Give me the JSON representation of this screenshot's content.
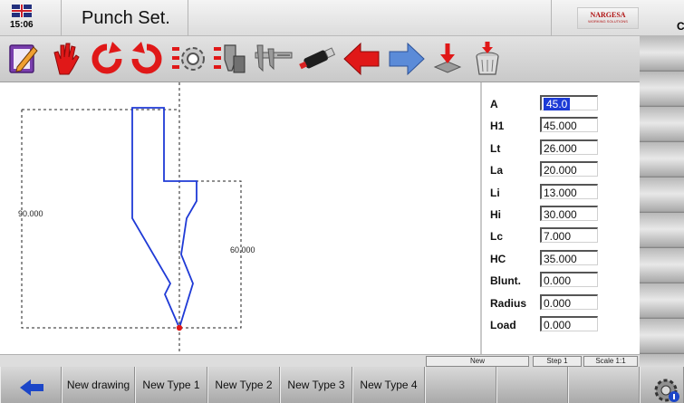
{
  "header": {
    "time": "15:06",
    "title": "Punch Set.",
    "logo_brand": "NARGESA",
    "logo_tagline": "WORKING SOLUTIONS",
    "right_cutoff_text": "C"
  },
  "toolbar": {
    "icons": [
      "edit-icon",
      "hand-icon",
      "rotate-left-icon",
      "rotate-right-icon",
      "settings-gear-icon",
      "tool-library-icon",
      "caliper-icon",
      "usb-icon",
      "arrow-left-icon",
      "arrow-right-icon",
      "save-icon",
      "trash-icon"
    ]
  },
  "drawing": {
    "dim_left": "90.000",
    "dim_right": "60.000"
  },
  "params": [
    {
      "label": "A",
      "value": "45.0",
      "selected": true
    },
    {
      "label": "H1",
      "value": "45.000"
    },
    {
      "label": "Lt",
      "value": "26.000"
    },
    {
      "label": "La",
      "value": "20.000"
    },
    {
      "label": "Li",
      "value": "13.000"
    },
    {
      "label": "Hi",
      "value": "30.000"
    },
    {
      "label": "Lc",
      "value": "7.000"
    },
    {
      "label": "HC",
      "value": "35.000"
    },
    {
      "label": "Blunt.",
      "value": "0.000"
    },
    {
      "label": "Radius",
      "value": "0.000"
    },
    {
      "label": "Load",
      "value": "0.000"
    }
  ],
  "status": {
    "mode": "New",
    "step": "Step 1",
    "scale": "Scale 1:1"
  },
  "bottom": {
    "buttons": [
      "New drawing",
      "New Type 1",
      "New Type 2",
      "New Type 3",
      "New Type 4"
    ]
  },
  "colors": {
    "profile": "#1f3ad6",
    "selection": "#1d3bd6",
    "arrow_red": "#e01818",
    "arrow_blue": "#5b8bd8"
  }
}
